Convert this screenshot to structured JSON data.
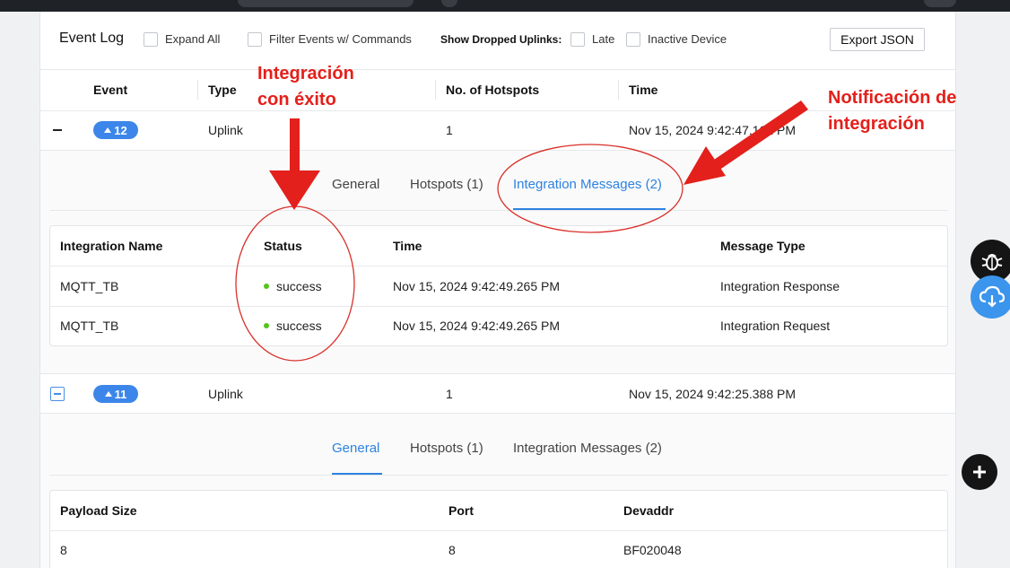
{
  "header": {
    "title": "Event Log",
    "expand_all": "Expand All",
    "filter_events": "Filter Events w/ Commands",
    "show_dropped": "Show Dropped Uplinks:",
    "late": "Late",
    "inactive_device": "Inactive Device",
    "export_json": "Export JSON"
  },
  "columns": {
    "event": "Event",
    "type": "Type",
    "hotspots": "No. of Hotspots",
    "time": "Time"
  },
  "events": [
    {
      "id": "12",
      "type": "Uplink",
      "hotspots": "1",
      "time": "Nov 15, 2024 9:42:47.162 PM"
    },
    {
      "id": "11",
      "type": "Uplink",
      "hotspots": "1",
      "time": "Nov 15, 2024 9:42:25.388 PM"
    }
  ],
  "tabs": [
    "General",
    "Hotspots (1)",
    "Integration Messages (2)"
  ],
  "integration_table": {
    "headers": [
      "Integration Name",
      "Status",
      "Time",
      "Message Type"
    ],
    "rows": [
      {
        "name": "MQTT_TB",
        "status": "success",
        "time": "Nov 15, 2024 9:42:49.265 PM",
        "type": "Integration Response"
      },
      {
        "name": "MQTT_TB",
        "status": "success",
        "time": "Nov 15, 2024 9:42:49.265 PM",
        "type": "Integration Request"
      }
    ]
  },
  "general_table": {
    "headers": [
      "Payload Size",
      "Port",
      "Devaddr"
    ],
    "rows": [
      {
        "payload_size": "8",
        "port": "8",
        "devaddr": "BF020048"
      }
    ]
  },
  "annotations": {
    "success_line1": "Integración",
    "success_line2": "con éxito",
    "notif_line1": "Notificación de",
    "notif_line2": "integración"
  },
  "colors": {
    "accent": "#2e82e0",
    "badge": "#3c86ea",
    "success": "#52c41a",
    "annotation": "#e3201b"
  },
  "icons": [
    "bug-icon",
    "cloud-download-icon",
    "plus-icon",
    "arrow-up-icon",
    "collapse-icon"
  ]
}
